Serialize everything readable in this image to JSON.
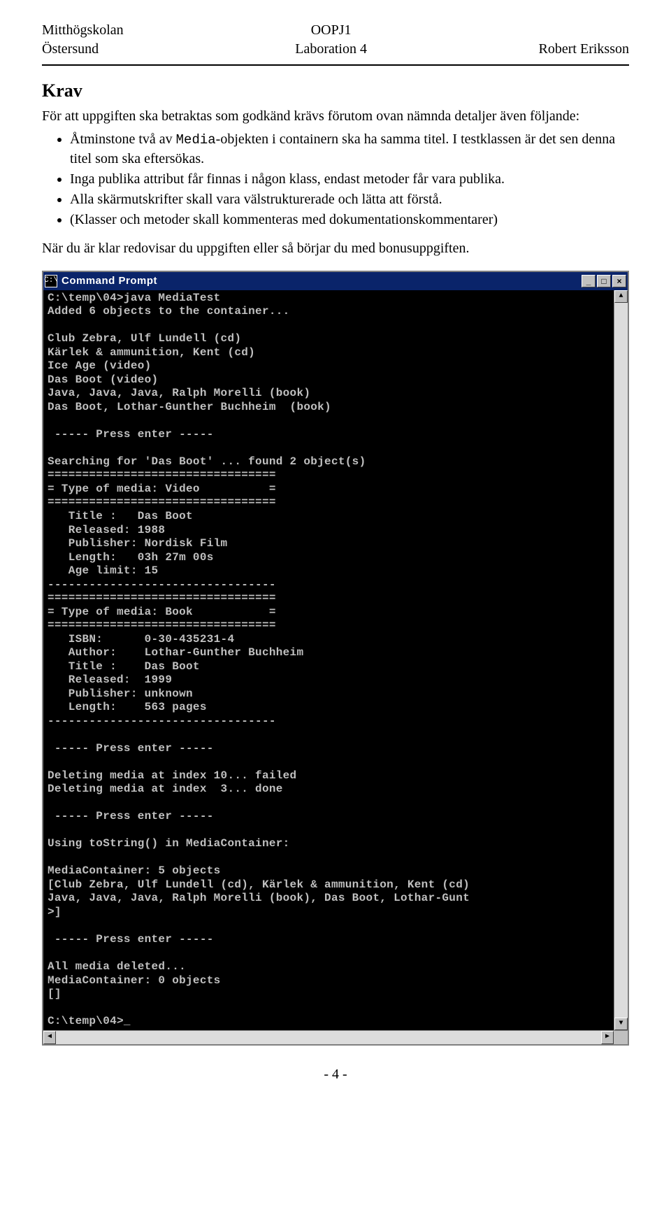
{
  "header": {
    "left1": "Mitthögskolan",
    "left2": "Östersund",
    "center1": "OOPJ1",
    "center2": "Laboration 4",
    "right": "Robert Eriksson"
  },
  "section_title": "Krav",
  "intro_para": "För att uppgiften ska betraktas som godkänd krävs förutom ovan nämnda detaljer även följande:",
  "bullets": [
    {
      "pre": "Åtminstone två av ",
      "code": "Media",
      "post": "-objekten i containern ska ha samma titel. I testklassen är det sen denna titel som ska eftersökas."
    },
    {
      "text": "Inga publika attribut får finnas i någon klass, endast metoder får vara publika."
    },
    {
      "text": "Alla skärmutskrifter skall vara välstrukturerade och lätta att förstå."
    },
    {
      "text": "(Klasser och metoder skall kommenteras med dokumentationskommentarer)"
    }
  ],
  "closing_para": "När du är klar redovisar du uppgiften eller så börjar du med bonusuppgiften.",
  "cmd": {
    "title": "Command Prompt",
    "icon_label": "C:\\",
    "buttons": {
      "min": "_",
      "max": "□",
      "close": "×"
    },
    "output": "C:\\temp\\04>java MediaTest\nAdded 6 objects to the container...\n\nClub Zebra, Ulf Lundell (cd)\nKärlek & ammunition, Kent (cd)\nIce Age (video)\nDas Boot (video)\nJava, Java, Java, Ralph Morelli (book)\nDas Boot, Lothar-Gunther Buchheim  (book)\n\n ----- Press enter -----\n\nSearching for 'Das Boot' ... found 2 object(s)\n=================================\n= Type of media: Video          =\n=================================\n   Title :   Das Boot\n   Released: 1988\n   Publisher: Nordisk Film\n   Length:   03h 27m 00s\n   Age limit: 15\n---------------------------------\n=================================\n= Type of media: Book           =\n=================================\n   ISBN:      0-30-435231-4\n   Author:    Lothar-Gunther Buchheim\n   Title :    Das Boot\n   Released:  1999\n   Publisher: unknown\n   Length:    563 pages\n---------------------------------\n\n ----- Press enter -----\n\nDeleting media at index 10... failed\nDeleting media at index  3... done\n\n ----- Press enter -----\n\nUsing toString() in MediaContainer:\n\nMediaContainer: 5 objects\n[Club Zebra, Ulf Lundell (cd), Kärlek & ammunition, Kent (cd)\nJava, Java, Java, Ralph Morelli (book), Das Boot, Lothar-Gunt\n>]\n\n ----- Press enter -----\n\nAll media deleted...\nMediaContainer: 0 objects\n[]\n\nC:\\temp\\04>_"
  },
  "page_number": "- 4 -"
}
